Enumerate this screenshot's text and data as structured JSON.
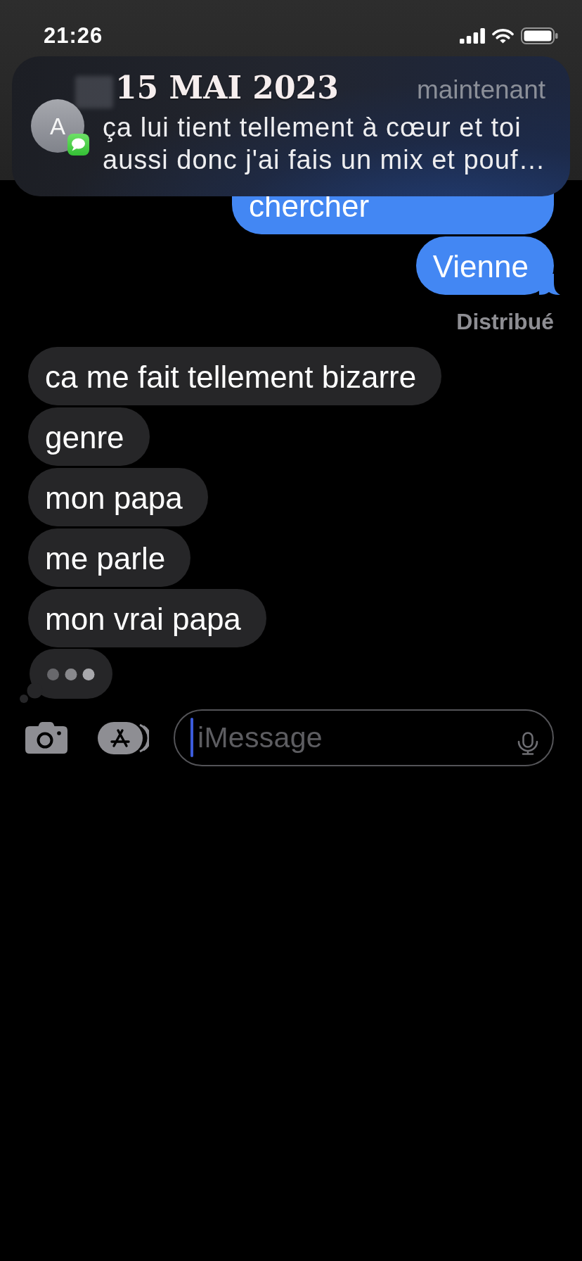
{
  "status_bar": {
    "time": "21:26"
  },
  "notification": {
    "avatar_initial": "A",
    "date_stamp": "15 MAI 2023",
    "time": "maintenant",
    "message": "ça lui tient tellement à cœur et toi aussi donc j'ai fais un mix et pouf…"
  },
  "thread": [
    {
      "kind": "message",
      "outgoing": true,
      "text": "chercher",
      "tail": false
    },
    {
      "kind": "message",
      "outgoing": true,
      "text": "Vienne",
      "tail": true
    },
    {
      "kind": "receipt",
      "text": "Distribué"
    },
    {
      "kind": "message",
      "outgoing": false,
      "text": "ca me fait tellement bizarre",
      "tail": false
    },
    {
      "kind": "message",
      "outgoing": false,
      "text": "genre",
      "tail": false
    },
    {
      "kind": "message",
      "outgoing": false,
      "text": "mon papa",
      "tail": false
    },
    {
      "kind": "message",
      "outgoing": false,
      "text": "me parle",
      "tail": false
    },
    {
      "kind": "message",
      "outgoing": false,
      "text": "mon vrai papa",
      "tail": false
    },
    {
      "kind": "typing"
    }
  ],
  "composer": {
    "placeholder": "iMessage",
    "focused": true
  }
}
